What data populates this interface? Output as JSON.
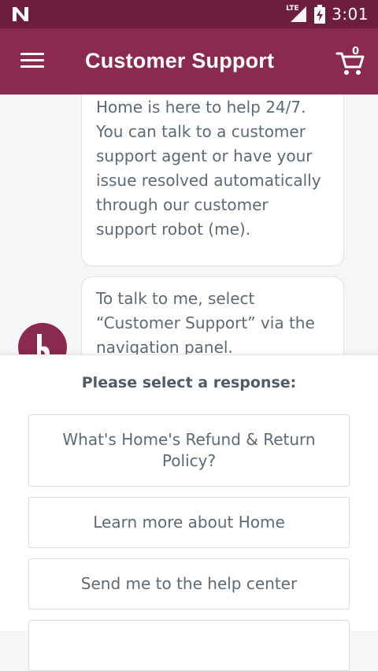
{
  "status_bar": {
    "network_label": "LTE",
    "time": "3:01"
  },
  "app_bar": {
    "title": "Customer Support",
    "cart_count": "0"
  },
  "chat": {
    "messages": [
      "Home is here to help 24/7. You can talk to a customer support agent or have your issue resolved automatically through our customer support robot (me).",
      "To talk to me, select “Customer Support” via the navigation panel."
    ]
  },
  "responses": {
    "heading": "Please select a response:",
    "options": [
      "What's Home's Refund & Return Policy?",
      "Learn more about Home",
      "Send me to the help center",
      ""
    ]
  },
  "colors": {
    "status_bar": "#6e1e3d",
    "app_bar": "#8a2a4e",
    "chat_background": "#f5f6f8",
    "text": "#5d6975"
  },
  "icons": {
    "status_left": "n-logo-icon",
    "signal": "signal-icon",
    "battery": "battery-charging-icon",
    "menu": "hamburger-menu-icon",
    "cart": "shopping-cart-icon",
    "avatar": "bot-avatar-icon"
  }
}
